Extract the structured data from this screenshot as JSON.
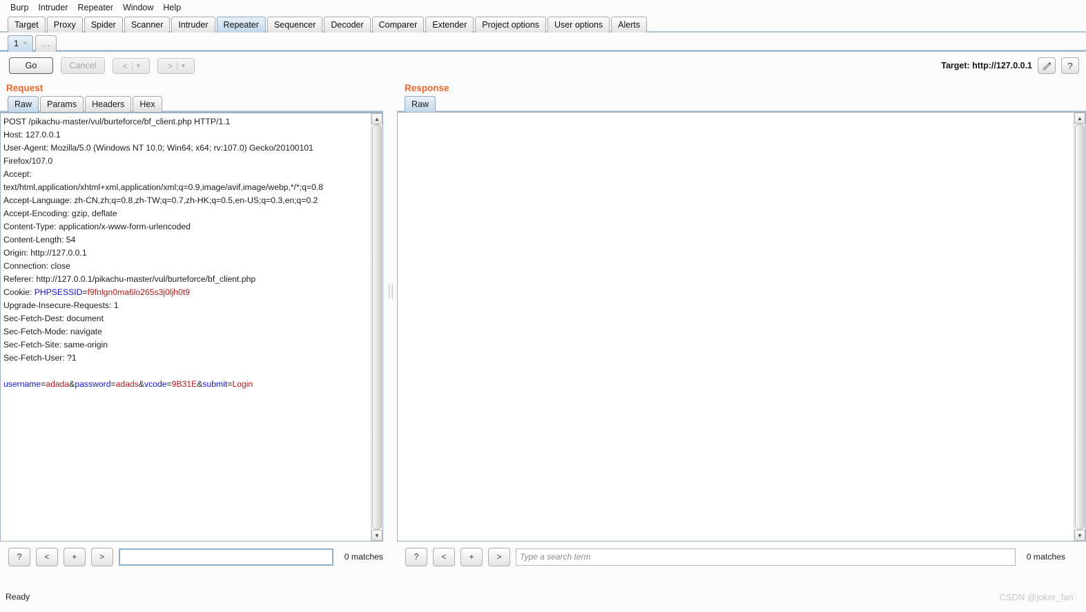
{
  "menubar": [
    "Burp",
    "Intruder",
    "Repeater",
    "Window",
    "Help"
  ],
  "main_tabs": [
    {
      "label": "Target",
      "selected": false
    },
    {
      "label": "Proxy",
      "selected": false
    },
    {
      "label": "Spider",
      "selected": false
    },
    {
      "label": "Scanner",
      "selected": false
    },
    {
      "label": "Intruder",
      "selected": false
    },
    {
      "label": "Repeater",
      "selected": true
    },
    {
      "label": "Sequencer",
      "selected": false
    },
    {
      "label": "Decoder",
      "selected": false
    },
    {
      "label": "Comparer",
      "selected": false
    },
    {
      "label": "Extender",
      "selected": false
    },
    {
      "label": "Project options",
      "selected": false
    },
    {
      "label": "User options",
      "selected": false
    },
    {
      "label": "Alerts",
      "selected": false
    }
  ],
  "repeater_tabs": {
    "items": [
      {
        "label": "1",
        "close": "×",
        "selected": true
      }
    ],
    "more_label": "..."
  },
  "toolbar": {
    "go_label": "Go",
    "cancel_label": "Cancel",
    "back_arrow": "<",
    "back_caret": "▾",
    "fwd_arrow": ">",
    "fwd_caret": "▾",
    "separator": "|",
    "target_label": "Target: http://127.0.0.1",
    "edit_icon": "✎",
    "help_icon": "?"
  },
  "request": {
    "title": "Request",
    "tabs": [
      {
        "label": "Raw",
        "selected": true
      },
      {
        "label": "Params",
        "selected": false
      },
      {
        "label": "Headers",
        "selected": false
      },
      {
        "label": "Hex",
        "selected": false
      }
    ],
    "lines": [
      {
        "text": "POST /pikachu-master/vul/burteforce/bf_client.php HTTP/1.1"
      },
      {
        "text": "Host: 127.0.0.1"
      },
      {
        "text": "User-Agent: Mozilla/5.0 (Windows NT 10.0; Win64; x64; rv:107.0) Gecko/20100101"
      },
      {
        "text": "Firefox/107.0"
      },
      {
        "text": "Accept:"
      },
      {
        "text": "text/html,application/xhtml+xml,application/xml;q=0.9,image/avif,image/webp,*/*;q=0.8"
      },
      {
        "text": "Accept-Language: zh-CN,zh;q=0.8,zh-TW;q=0.7,zh-HK;q=0.5,en-US;q=0.3,en;q=0.2"
      },
      {
        "text": "Accept-Encoding: gzip, deflate"
      },
      {
        "text": "Content-Type: application/x-www-form-urlencoded"
      },
      {
        "text": "Content-Length: 54"
      },
      {
        "text": "Origin: http://127.0.0.1"
      },
      {
        "text": "Connection: close"
      },
      {
        "text": "Referer: http://127.0.0.1/pikachu-master/vul/burteforce/bf_client.php"
      },
      {
        "text": "Cookie: ",
        "parts": [
          {
            "t": "Cookie: ",
            "c": "plain"
          },
          {
            "t": "PHPSESSID",
            "c": "blue"
          },
          {
            "t": "=",
            "c": "plain"
          },
          {
            "t": "f9fnlgn0ma6lo265s3j0ljh0t9",
            "c": "red"
          }
        ]
      },
      {
        "text": "Upgrade-Insecure-Requests: 1"
      },
      {
        "text": "Sec-Fetch-Dest: document"
      },
      {
        "text": "Sec-Fetch-Mode: navigate"
      },
      {
        "text": "Sec-Fetch-Site: same-origin"
      },
      {
        "text": "Sec-Fetch-User: ?1"
      },
      {
        "text": ""
      },
      {
        "text": "username=adada&password=adads&vcode=9B31E&submit=Login",
        "parts": [
          {
            "t": "username",
            "c": "blue"
          },
          {
            "t": "=",
            "c": "plain"
          },
          {
            "t": "adada",
            "c": "red"
          },
          {
            "t": "&",
            "c": "plain"
          },
          {
            "t": "password",
            "c": "blue"
          },
          {
            "t": "=",
            "c": "plain"
          },
          {
            "t": "adads",
            "c": "red"
          },
          {
            "t": "&",
            "c": "plain"
          },
          {
            "t": "vcode",
            "c": "blue"
          },
          {
            "t": "=",
            "c": "plain"
          },
          {
            "t": "9B31E",
            "c": "red"
          },
          {
            "t": "&",
            "c": "plain"
          },
          {
            "t": "submit",
            "c": "blue"
          },
          {
            "t": "=",
            "c": "plain"
          },
          {
            "t": "Login",
            "c": "red"
          }
        ]
      }
    ],
    "search": {
      "help_label": "?",
      "prev_label": "<",
      "add_label": "+",
      "next_label": ">",
      "value": "",
      "placeholder": "",
      "matches": "0 matches"
    }
  },
  "response": {
    "title": "Response",
    "tabs": [
      {
        "label": "Raw",
        "selected": true
      }
    ],
    "body": "",
    "search": {
      "help_label": "?",
      "prev_label": "<",
      "add_label": "+",
      "next_label": ">",
      "value": "",
      "placeholder": "Type a search term",
      "matches": "0 matches"
    }
  },
  "statusbar": {
    "status": "Ready",
    "watermark": "CSDN @joker_fan`"
  },
  "colors": {
    "accent_orange": "#e8662a",
    "tab_selected": "#c3d8ec",
    "param_name": "#1414c8",
    "param_value": "#b01a1a"
  }
}
